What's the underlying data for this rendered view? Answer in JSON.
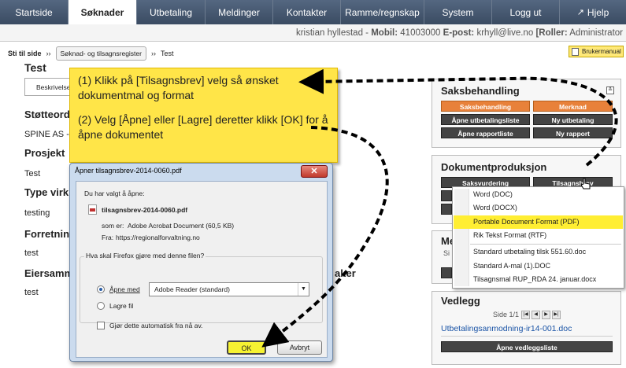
{
  "nav": {
    "tabs": [
      "Startside",
      "Søknader",
      "Utbetaling",
      "Meldinger",
      "Kontakter",
      "Ramme/regnskap",
      "System",
      "Logg ut",
      "Hjelp"
    ],
    "active": "Søknader"
  },
  "userbar": {
    "name": "kristian hyllestad",
    "mobile_label": "Mobil:",
    "mobile": "41003000",
    "email_label": "E-post:",
    "email": "krhyll@live.no",
    "roles_label": "[Roller:",
    "roles": "Administrator"
  },
  "breadcrumb": {
    "home": "Sti til side",
    "sep": "››",
    "register": "Søknad- og tilsagnsregister",
    "current": "Test"
  },
  "manual_label": "Brukermanual",
  "page": {
    "title": "Test",
    "tab": "Beskrivelse",
    "fields": [
      {
        "label": "Støtteord",
        "value": "SPINE AS -"
      },
      {
        "label": "Prosjekt",
        "value": "Test"
      },
      {
        "label": "Type virk",
        "value": "testing"
      },
      {
        "label": "Forretnin",
        "value": "test"
      },
      {
        "label": "Eiersamm",
        "value": "test"
      }
    ],
    "partial_label": "aker"
  },
  "callout": {
    "step1": "(1) Klikk på [Tilsagnsbrev] velg så ønsket dokumentmal og format",
    "step2": "(2) Velg [Åpne] eller [Lagre] deretter klikk [OK] for å åpne dokumentet"
  },
  "saksbehandling": {
    "title": "Saksbehandling",
    "buttons": [
      "Saksbehandling",
      "Merknad",
      "Åpne utbetalingsliste",
      "Ny utbetaling",
      "Åpne rapportliste",
      "Ny rapport"
    ]
  },
  "dokumentproduksjon": {
    "title": "Dokumentproduksjon",
    "buttons": [
      "Saksvurdering",
      "Tilsagnsbrev"
    ]
  },
  "menu": {
    "items": [
      "Word (DOC)",
      "Word (DOCX)",
      "Portable Document Format (PDF)",
      "Rik Tekst Format (RTF)",
      "Standard utbetaling tilsk 551.60.doc",
      "Standard A-mal (1).DOC",
      "Tilsagnsmal RUP_RDA 24. januar.docx"
    ],
    "highlighted": "Portable Document Format (PDF)"
  },
  "middle_panel": {
    "title_fragment": "Me",
    "text_fragment": "Si"
  },
  "vedlegg": {
    "title": "Vedlegg",
    "pager": "Side 1/1",
    "pager_icons": [
      "first-page-icon",
      "prev-page-icon",
      "next-page-icon",
      "last-page-icon"
    ],
    "file": "Utbetalingsanmodning-ir14-001.doc",
    "button": "Åpne vedleggsliste"
  },
  "dialog": {
    "title": "Åpner tilsagnsbrev-2014-0060.pdf",
    "close": "✕",
    "intro": "Du har valgt å åpne:",
    "filename": "tilsagnsbrev-2014-0060.pdf",
    "type_label": "som er:",
    "type": "Adobe Acrobat Document (60,5 KB)",
    "from_label": "Fra:",
    "from": "https://regionalforvaltning.no",
    "question": "Hva skal Firefox gjøre med denne filen?",
    "open_with": "Åpne med",
    "app": "Adobe Reader  (standard)",
    "save": "Lagre fil",
    "auto": "Gjør dette automatisk fra nå av.",
    "ok": "OK",
    "cancel": "Avbryt"
  },
  "colors": {
    "nav": "#3d4f66",
    "orange": "#e8813a",
    "callout": "#ffe548",
    "highlight": "#ffee33"
  }
}
